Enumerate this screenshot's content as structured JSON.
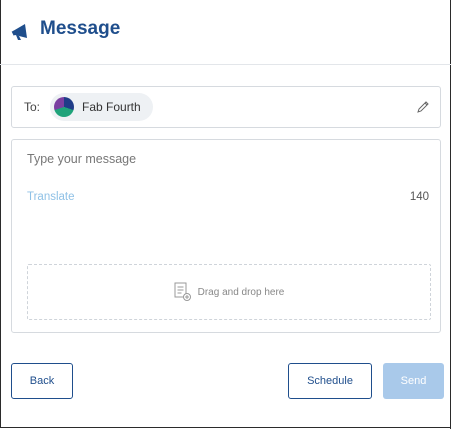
{
  "header": {
    "title": "Message",
    "icon": "megaphone-icon"
  },
  "recipient": {
    "label": "To:",
    "name": "Fab Fourth",
    "edit_icon": "pencil-icon"
  },
  "message": {
    "placeholder": "Type your message",
    "translate_label": "Translate",
    "char_count": "140",
    "dropzone_text": "Drag and drop here",
    "dropzone_icon": "file-add-icon"
  },
  "actions": {
    "back": "Back",
    "schedule": "Schedule",
    "send": "Send"
  },
  "colors": {
    "primary": "#1f4e8c",
    "send_disabled": "#a9c9ea",
    "link": "#8fc1e6"
  }
}
